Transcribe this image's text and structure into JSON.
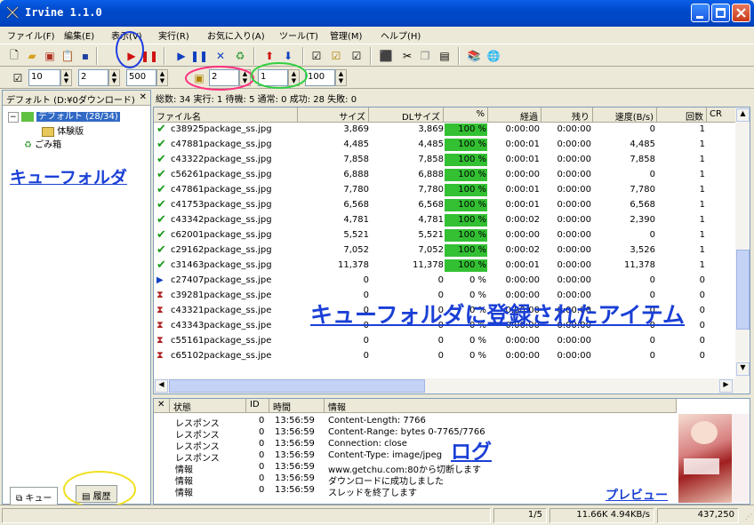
{
  "window": {
    "title": "Irvine 1.1.0"
  },
  "menu": [
    "ファイル(F)",
    "編集(E)",
    "表示(V)",
    "実行(R)",
    "お気に入り(A)",
    "ツール(T)",
    "管理(M)",
    "ヘルプ(H)"
  ],
  "toolbar2": {
    "v1": "10",
    "v2": "2",
    "v3": "500",
    "v4": "2",
    "v5": "1",
    "v6": "100"
  },
  "left": {
    "header": "デフォルト (D:¥0ダウンロード)",
    "close": "✕",
    "root": "デフォルト (28/34)",
    "child": "体験版",
    "trash": "ごみ箱",
    "tab_queue": "キュー",
    "tab_history": "履歴"
  },
  "summary": "総数: 34  実行: 1  待機: 5  通常: 0  成功: 28  失敗: 0",
  "columns": [
    "ファイル名",
    "サイズ",
    "DLサイズ",
    "%",
    "経過",
    "残り",
    "速度(B/s)",
    "回数",
    "CR"
  ],
  "rows": [
    {
      "name": "c38925package_ss.jpg",
      "size": "3,869",
      "dl": "3,869",
      "pct": "100 %",
      "el": "0:00:00",
      "rem": "0:00:00",
      "spd": "0",
      "cnt": "1",
      "st": "ok"
    },
    {
      "name": "c47881package_ss.jpg",
      "size": "4,485",
      "dl": "4,485",
      "pct": "100 %",
      "el": "0:00:01",
      "rem": "0:00:00",
      "spd": "4,485",
      "cnt": "1",
      "st": "ok"
    },
    {
      "name": "c43322package_ss.jpg",
      "size": "7,858",
      "dl": "7,858",
      "pct": "100 %",
      "el": "0:00:01",
      "rem": "0:00:00",
      "spd": "7,858",
      "cnt": "1",
      "st": "ok"
    },
    {
      "name": "c56261package_ss.jpg",
      "size": "6,888",
      "dl": "6,888",
      "pct": "100 %",
      "el": "0:00:00",
      "rem": "0:00:00",
      "spd": "0",
      "cnt": "1",
      "st": "ok"
    },
    {
      "name": "c47861package_ss.jpg",
      "size": "7,780",
      "dl": "7,780",
      "pct": "100 %",
      "el": "0:00:01",
      "rem": "0:00:00",
      "spd": "7,780",
      "cnt": "1",
      "st": "ok"
    },
    {
      "name": "c41753package_ss.jpg",
      "size": "6,568",
      "dl": "6,568",
      "pct": "100 %",
      "el": "0:00:01",
      "rem": "0:00:00",
      "spd": "6,568",
      "cnt": "1",
      "st": "ok"
    },
    {
      "name": "c43342package_ss.jpg",
      "size": "4,781",
      "dl": "4,781",
      "pct": "100 %",
      "el": "0:00:02",
      "rem": "0:00:00",
      "spd": "2,390",
      "cnt": "1",
      "st": "ok"
    },
    {
      "name": "c62001package_ss.jpg",
      "size": "5,521",
      "dl": "5,521",
      "pct": "100 %",
      "el": "0:00:00",
      "rem": "0:00:00",
      "spd": "0",
      "cnt": "1",
      "st": "ok"
    },
    {
      "name": "c29162package_ss.jpg",
      "size": "7,052",
      "dl": "7,052",
      "pct": "100 %",
      "el": "0:00:02",
      "rem": "0:00:00",
      "spd": "3,526",
      "cnt": "1",
      "st": "ok"
    },
    {
      "name": "c31463package_ss.jpg",
      "size": "11,378",
      "dl": "11,378",
      "pct": "100 %",
      "el": "0:00:01",
      "rem": "0:00:00",
      "spd": "11,378",
      "cnt": "1",
      "st": "ok"
    },
    {
      "name": "c27407package_ss.jpe",
      "size": "0",
      "dl": "0",
      "pct": "0 %",
      "el": "0:00:00",
      "rem": "0:00:00",
      "spd": "0",
      "cnt": "0",
      "st": "run"
    },
    {
      "name": "c39281package_ss.jpe",
      "size": "0",
      "dl": "0",
      "pct": "0 %",
      "el": "0:00:00",
      "rem": "0:00:00",
      "spd": "0",
      "cnt": "0",
      "st": "wait"
    },
    {
      "name": "c43321package_ss.jpe",
      "size": "0",
      "dl": "0",
      "pct": "0 %",
      "el": "0:00:00",
      "rem": "0:00:00",
      "spd": "0",
      "cnt": "0",
      "st": "wait"
    },
    {
      "name": "c43343package_ss.jpe",
      "size": "0",
      "dl": "0",
      "pct": "0 %",
      "el": "0:00:00",
      "rem": "0:00:00",
      "spd": "0",
      "cnt": "0",
      "st": "wait"
    },
    {
      "name": "c55161package_ss.jpe",
      "size": "0",
      "dl": "0",
      "pct": "0 %",
      "el": "0:00:00",
      "rem": "0:00:00",
      "spd": "0",
      "cnt": "0",
      "st": "wait"
    },
    {
      "name": "c65102package_ss.jpe",
      "size": "0",
      "dl": "0",
      "pct": "0 %",
      "el": "0:00:00",
      "rem": "0:00:00",
      "spd": "0",
      "cnt": "0",
      "st": "wait"
    }
  ],
  "log": {
    "close": "✕",
    "cols": [
      "状態",
      "ID",
      "時間",
      "情報"
    ],
    "rows": [
      {
        "s": "レスポンス",
        "id": "0",
        "t": "13:56:59",
        "info": "Content-Length: 7766"
      },
      {
        "s": "レスポンス",
        "id": "0",
        "t": "13:56:59",
        "info": "Content-Range: bytes 0-7765/7766"
      },
      {
        "s": "レスポンス",
        "id": "0",
        "t": "13:56:59",
        "info": "Connection: close"
      },
      {
        "s": "レスポンス",
        "id": "0",
        "t": "13:56:59",
        "info": "Content-Type: image/jpeg"
      },
      {
        "s": "情報",
        "id": "0",
        "t": "13:56:59",
        "info": "www.getchu.com:80から切断します"
      },
      {
        "s": "情報",
        "id": "0",
        "t": "13:56:59",
        "info": "ダウンロードに成功しました"
      },
      {
        "s": "情報",
        "id": "0",
        "t": "13:56:59",
        "info": "スレッドを終了します"
      }
    ]
  },
  "statusbar": {
    "count": "1/5",
    "speed": "11.66K 4.94KB/s",
    "bytes": "437,250"
  },
  "annotations": {
    "queue_folder": "キューフォルダ",
    "items": "キューフォルダに登録されたアイテム",
    "log": "ログ",
    "preview": "プレビュー"
  },
  "colors": {
    "title": "#0a5fe8",
    "progress": "#33c033",
    "annot": "#1a3fd6",
    "check": "#1a9a1a"
  }
}
